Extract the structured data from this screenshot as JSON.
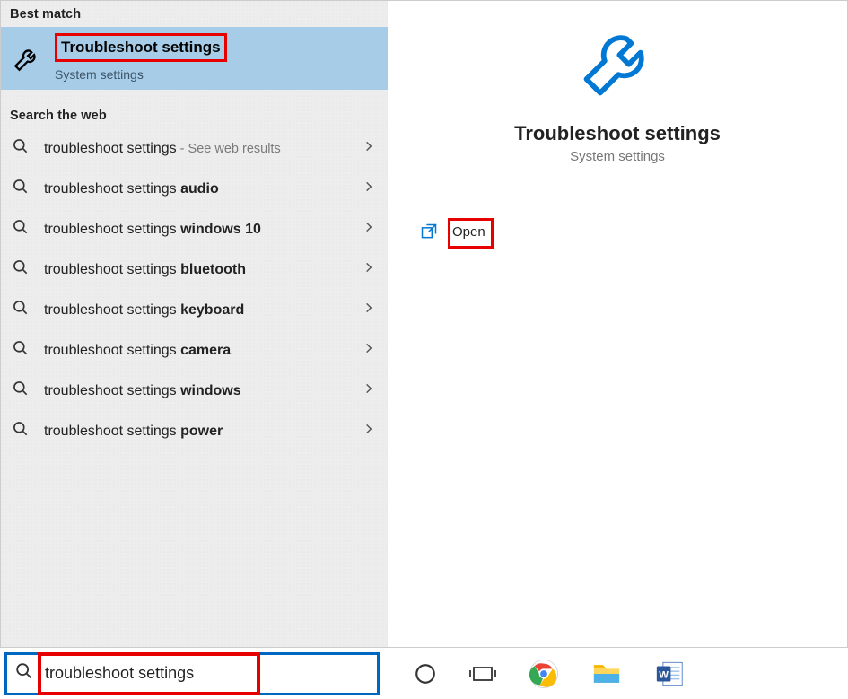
{
  "search_query": "troubleshoot settings",
  "left": {
    "best_match_label": "Best match",
    "best_match": {
      "title": "Troubleshoot settings",
      "subtitle": "System settings"
    },
    "web_label": "Search the web",
    "web_results": [
      {
        "prefix": "troubleshoot settings",
        "suffix": "",
        "extra": " - See web results"
      },
      {
        "prefix": "troubleshoot settings ",
        "suffix": "audio",
        "extra": ""
      },
      {
        "prefix": "troubleshoot settings ",
        "suffix": "windows 10",
        "extra": ""
      },
      {
        "prefix": "troubleshoot settings ",
        "suffix": "bluetooth",
        "extra": ""
      },
      {
        "prefix": "troubleshoot settings ",
        "suffix": "keyboard",
        "extra": ""
      },
      {
        "prefix": "troubleshoot settings ",
        "suffix": "camera",
        "extra": ""
      },
      {
        "prefix": "troubleshoot settings ",
        "suffix": "windows",
        "extra": ""
      },
      {
        "prefix": "troubleshoot settings ",
        "suffix": "power",
        "extra": ""
      }
    ]
  },
  "right": {
    "title": "Troubleshoot settings",
    "subtitle": "System settings",
    "open_label": "Open"
  },
  "highlight": {
    "color": "#e60000"
  }
}
